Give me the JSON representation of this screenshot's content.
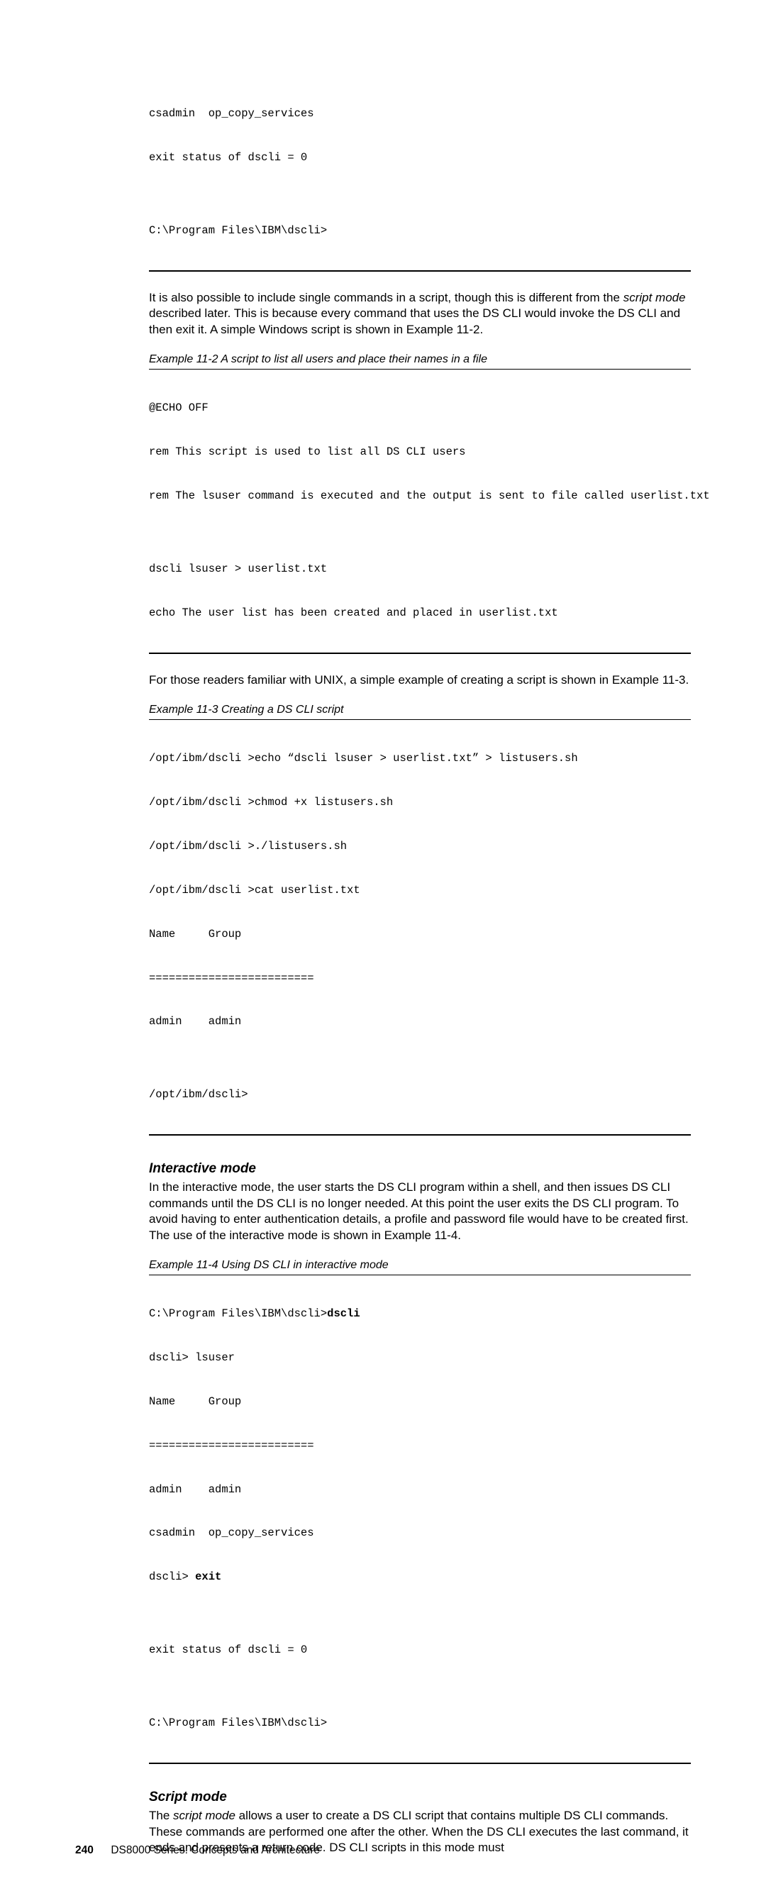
{
  "code1": {
    "l1": "csadmin  op_copy_services",
    "l2": "exit status of dscli = 0",
    "l3": "",
    "l4": "C:\\Program Files\\IBM\\dscli>"
  },
  "para1a": "It is also possible to include single commands in a script, though this is different from the ",
  "para1b": "script mode",
  "para1c": " described later. This is because every command that uses the DS CLI would invoke the DS CLI and then exit it. A simple Windows script is shown in Example 11-2.",
  "caption2": "Example 11-2   A script to list all users and place their names in a file",
  "code2": {
    "l1": "@ECHO OFF",
    "l2": "rem This script is used to list all DS CLI users",
    "l3": "rem The lsuser command is executed and the output is sent to file called userlist.txt",
    "l4": "",
    "l5": "dscli lsuser > userlist.txt",
    "l6": "echo The user list has been created and placed in userlist.txt"
  },
  "para2": "For those readers familiar with UNIX, a simple example of creating a script is shown in Example 11-3.",
  "caption3": "Example 11-3   Creating a DS CLI script",
  "code3": {
    "l1a": "/opt/ibm/dscli >echo ",
    "l1b": "“",
    "l1c": "dscli lsuser > userlist.txt",
    "l1d": "”",
    "l1e": " > listusers.sh",
    "l2": "/opt/ibm/dscli >chmod +x listusers.sh",
    "l3": "/opt/ibm/dscli >./listusers.sh",
    "l4": "/opt/ibm/dscli >cat userlist.txt",
    "l5": "Name     Group",
    "l6": "=========================",
    "l7": "admin    admin",
    "l8": "",
    "l9": "/opt/ibm/dscli>"
  },
  "head1": "Interactive mode",
  "para3": "In the interactive mode, the user starts the DS CLI program within a shell, and then issues DS CLI commands until the DS CLI is no longer needed. At this point the user exits the DS CLI program. To avoid having to enter authentication details, a profile and password file would have to be created first. The use of the interactive mode is shown in Example 11-4.",
  "caption4": "Example 11-4   Using DS CLI in interactive mode",
  "code4": {
    "l1a": "C:\\Program Files\\IBM\\dscli>",
    "l1b": "dscli",
    "l2": "dscli> lsuser",
    "l3": "Name     Group",
    "l4": "=========================",
    "l5": "admin    admin",
    "l6": "csadmin  op_copy_services",
    "l7a": "dscli> ",
    "l7b": "exit",
    "l8": "",
    "l9": "exit status of dscli = 0",
    "l10": "",
    "l11": "C:\\Program Files\\IBM\\dscli>"
  },
  "head2": "Script mode",
  "para4a": "The ",
  "para4b": "script mode",
  "para4c": " allows a user to create a DS CLI script that contains multiple DS CLI commands. These commands are performed one after the other. When the DS CLI executes the last command, it ends and presents a return code. DS CLI scripts in this mode must",
  "footer": {
    "page": "240",
    "title": "DS8000 Series: Concepts and Architecture"
  }
}
